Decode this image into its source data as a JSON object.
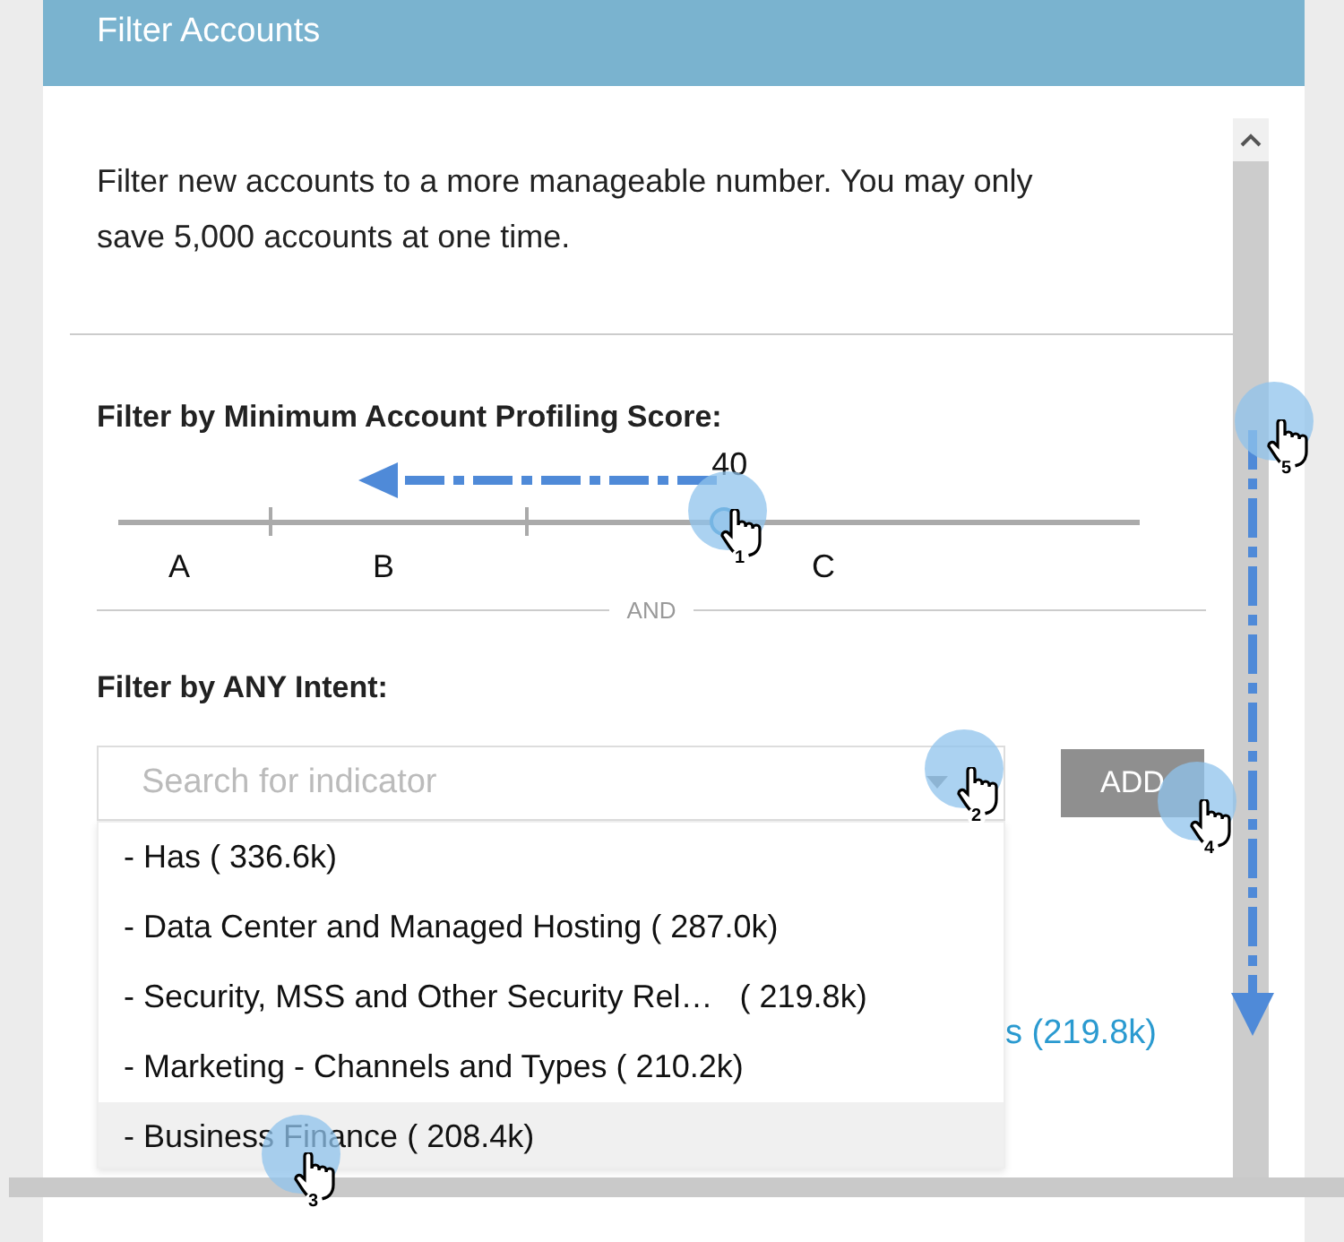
{
  "header": {
    "title": "Filter Accounts"
  },
  "description": "Filter new accounts to a more manageable number. You may only save 5,000 accounts at one time.",
  "score_filter": {
    "heading": "Filter by Minimum Account Profiling Score:",
    "value_label": "40",
    "level": 0.595,
    "grades": [
      "A",
      "B",
      "C"
    ]
  },
  "separator": "AND",
  "intent_filter": {
    "heading": "Filter by ANY Intent:",
    "search": {
      "placeholder": "Search for indicator"
    },
    "add_button": {
      "label": "ADD",
      "disabled": true
    },
    "behind_text": "s (219.8k)",
    "options": [
      {
        "label": "- Has ( 336.6k)",
        "selected": false
      },
      {
        "label": "- Data Center and Managed Hosting ( 287.0k)",
        "selected": false
      },
      {
        "label": "- Security, MSS and Other Security Rel…   ( 219.8k)",
        "selected": false
      },
      {
        "label": "- Marketing - Channels and Types ( 210.2k)",
        "selected": false
      },
      {
        "label": "- Business Finance ( 208.4k)",
        "selected": true
      }
    ]
  },
  "callouts": [
    {
      "number": "1"
    },
    {
      "number": "2"
    },
    {
      "number": "3"
    },
    {
      "number": "4"
    },
    {
      "number": "5"
    }
  ]
}
